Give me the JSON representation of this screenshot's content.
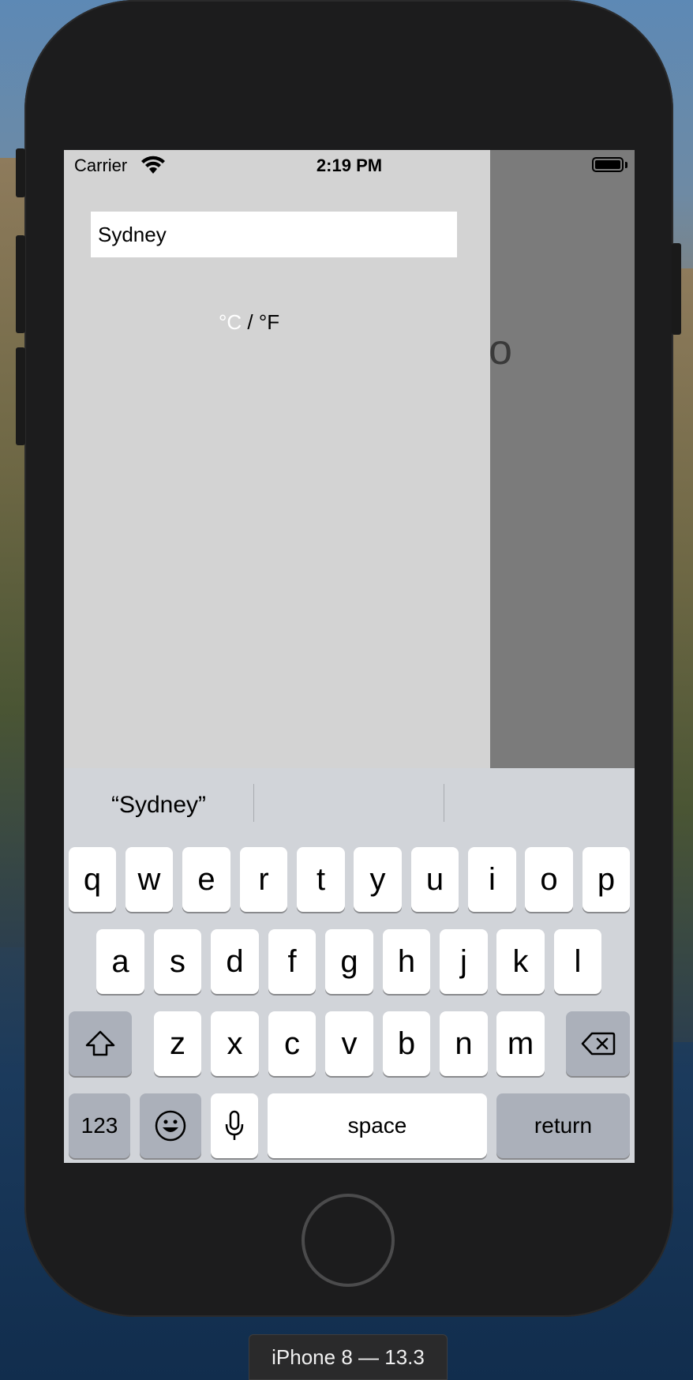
{
  "simulator": {
    "device_label": "iPhone 8 — 13.3"
  },
  "status_bar": {
    "carrier": "Carrier",
    "time": "2:19 PM"
  },
  "app": {
    "city_input": {
      "value": "Sydney",
      "placeholder": ""
    },
    "unit_toggle": {
      "celsius": "°C",
      "separator": " / ",
      "fahrenheit": "°F"
    },
    "partial_text": "o"
  },
  "keyboard": {
    "suggestions": [
      "“Sydney”",
      "",
      ""
    ],
    "row1": [
      "q",
      "w",
      "e",
      "r",
      "t",
      "y",
      "u",
      "i",
      "o",
      "p"
    ],
    "row2": [
      "a",
      "s",
      "d",
      "f",
      "g",
      "h",
      "j",
      "k",
      "l"
    ],
    "row3": [
      "z",
      "x",
      "c",
      "v",
      "b",
      "n",
      "m"
    ],
    "numbers_key": "123",
    "space_key": "space",
    "return_key": "return"
  },
  "colors": {
    "screen_background": "#d3d3d3",
    "side_panel": "#7b7b7b",
    "keyboard_background": "#d1d4d9",
    "device_body": "#1c1c1d"
  }
}
